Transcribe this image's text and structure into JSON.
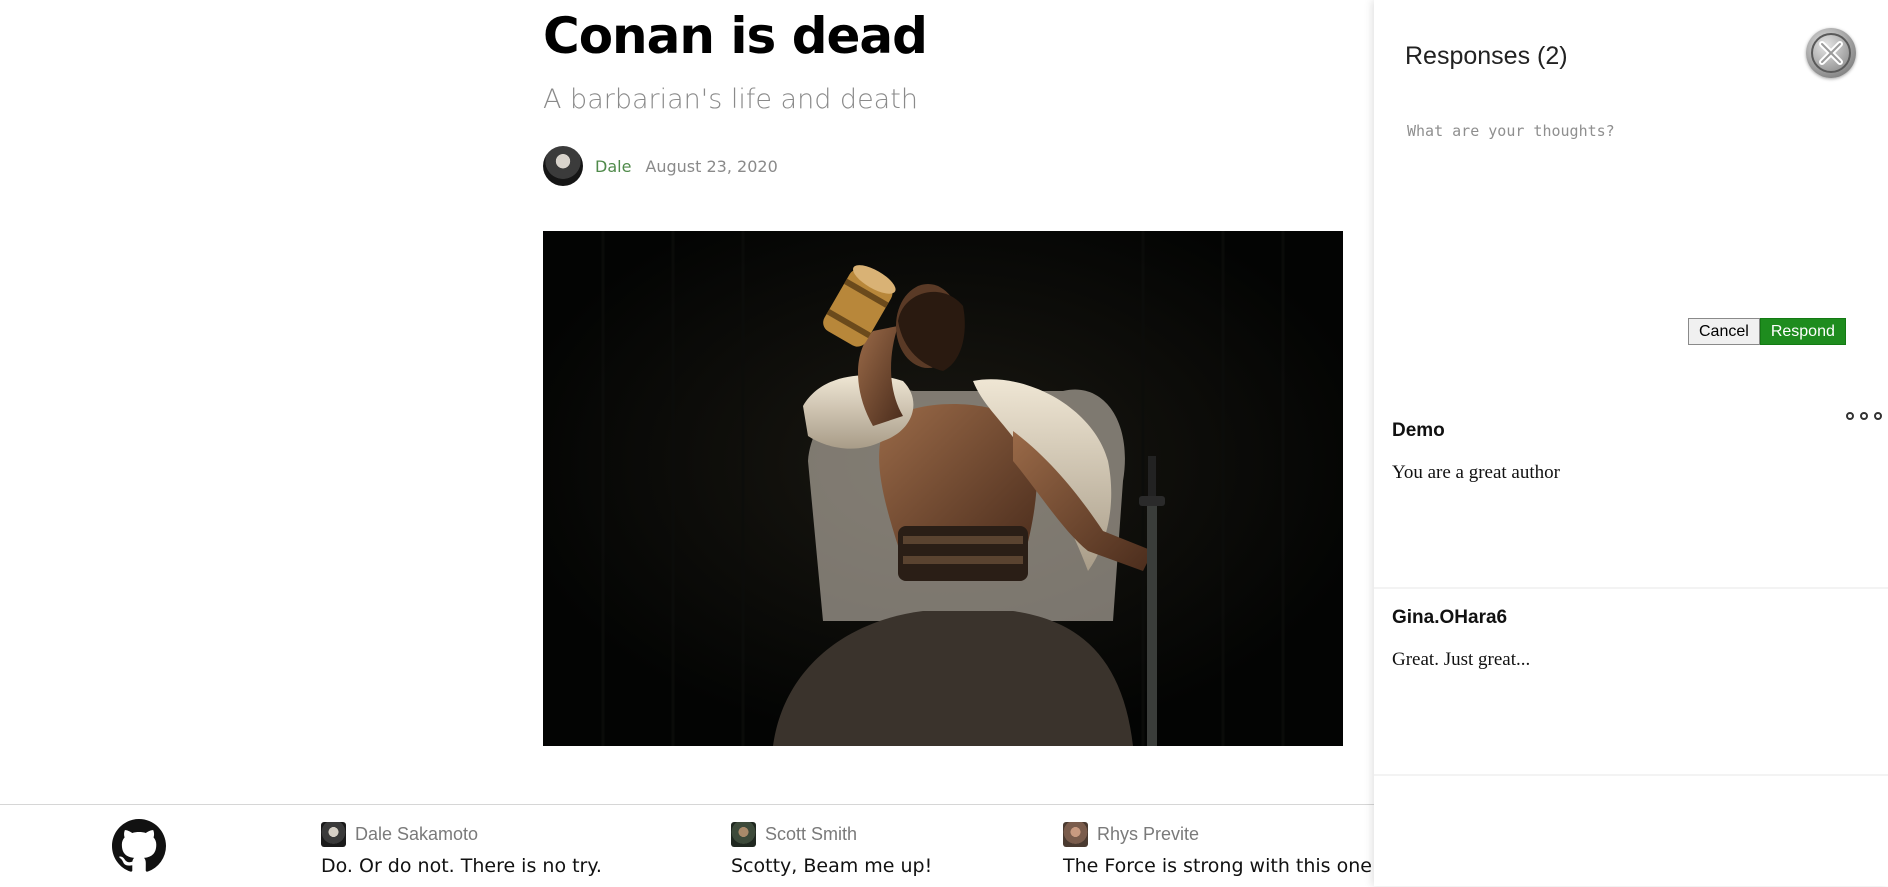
{
  "article": {
    "title": "Conan is dead",
    "subtitle": "A barbarian's life and death",
    "author": "Dale",
    "date": "August 23, 2020",
    "hero_image": "barbarian drinking from tankard on throne holding sword"
  },
  "footer": {
    "github_icon": "github-icon",
    "quotes": [
      {
        "name": "Dale Sakamoto",
        "text": "Do. Or do not. There is no try."
      },
      {
        "name": "Scott Smith",
        "text": "Scotty, Beam me up!"
      },
      {
        "name": "Rhys Previte",
        "text": "The Force is strong with this one"
      }
    ]
  },
  "responses_panel": {
    "title": "Responses (2)",
    "close_icon": "close-icon",
    "input": {
      "value": "",
      "placeholder": "What are your thoughts?"
    },
    "cancel_label": "Cancel",
    "respond_label": "Respond",
    "respond_color": "#1e8c1e",
    "responses": [
      {
        "author": "Demo",
        "text": "You are a great author",
        "more_icon": "more-options-icon"
      },
      {
        "author": "Gina.OHara6",
        "text": "Great. Just great..."
      }
    ]
  }
}
